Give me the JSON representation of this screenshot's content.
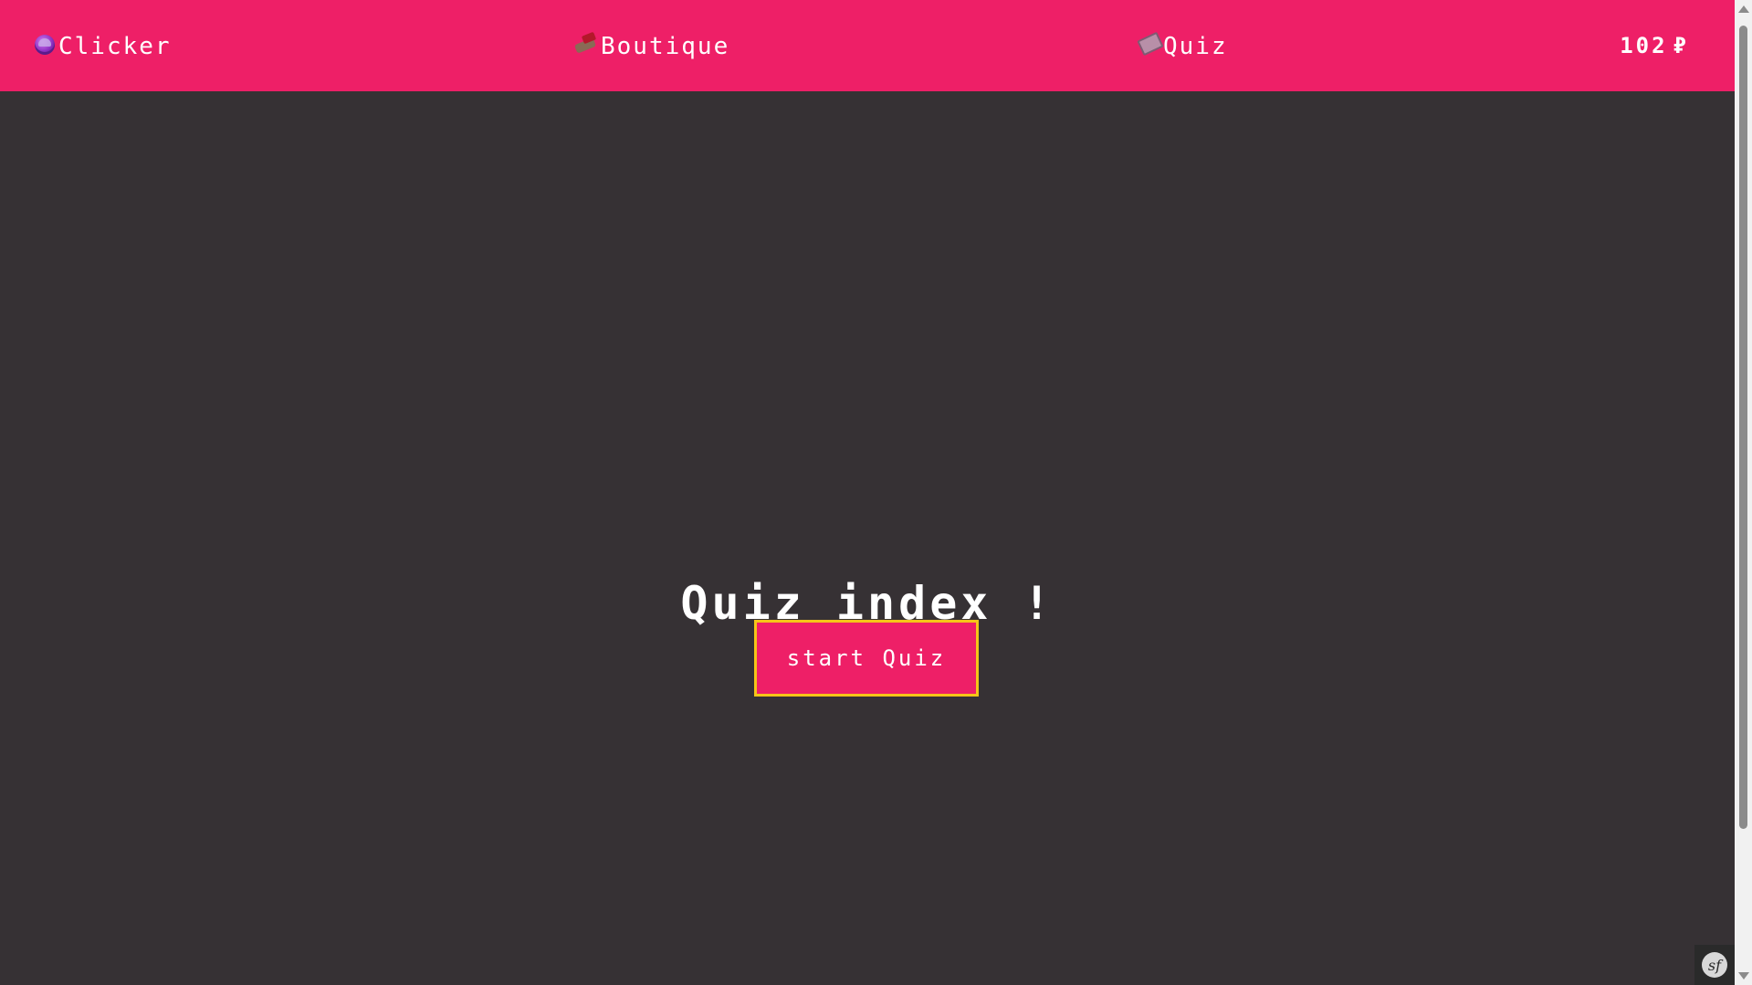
{
  "navbar": {
    "items": [
      {
        "label": "Clicker",
        "icon": "ball-icon"
      },
      {
        "label": "Boutique",
        "icon": "shop-icon"
      },
      {
        "label": "Quiz",
        "icon": "book-icon"
      }
    ],
    "counter": {
      "value": "102",
      "currency_symbol": "₽"
    }
  },
  "main": {
    "title": "Quiz index !",
    "start_button_label": "start Quiz"
  },
  "debug_toolbar": {
    "logo_text": "sf"
  },
  "colors": {
    "navbar_bg": "#ee1f67",
    "page_bg": "#363134",
    "button_border": "#f5c518",
    "text": "#ffffff"
  }
}
